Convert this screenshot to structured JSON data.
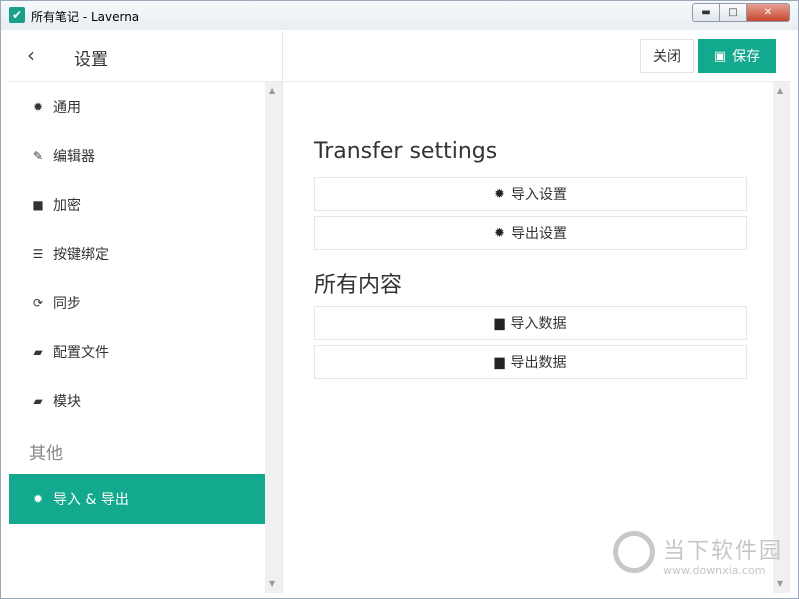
{
  "window": {
    "title": "所有笔记 - Laverna",
    "app_icon": "✔",
    "minimize": "▬",
    "maximize": "□",
    "close": "✕"
  },
  "sidebar": {
    "back_icon": "‹",
    "title": "设置",
    "items": [
      {
        "icon": "gear-icon",
        "glyph": "✹",
        "label": "通用"
      },
      {
        "icon": "pencil-icon",
        "glyph": "✎",
        "label": "编辑器"
      },
      {
        "icon": "lock-icon",
        "glyph": "■",
        "label": "加密"
      },
      {
        "icon": "keyboard-icon",
        "glyph": "☰",
        "label": "按键绑定"
      },
      {
        "icon": "sync-icon",
        "glyph": "⟳",
        "label": "同步"
      },
      {
        "icon": "book-icon",
        "glyph": "▰",
        "label": "配置文件"
      },
      {
        "icon": "book-icon",
        "glyph": "▰",
        "label": "模块"
      }
    ],
    "group_label": "其他",
    "active_item": {
      "icon": "gear-icon",
      "glyph": "✹",
      "label": "导入 & 导出"
    }
  },
  "toolbar": {
    "close_label": "关闭",
    "save_label": "保存",
    "save_glyph": "▣"
  },
  "main": {
    "section1_title": "Transfer settings",
    "import_settings": "导入设置",
    "export_settings": "导出设置",
    "section2_title": "所有内容",
    "import_data": "导入数据",
    "export_data": "导出数据",
    "gear_glyph": "✹",
    "file_glyph": "▆"
  },
  "scroll": {
    "up": "▲",
    "down": "▼"
  },
  "watermark": {
    "text": "当下软件园",
    "url": "www.downxia.com"
  },
  "colors": {
    "accent": "#13a98f",
    "sidebar_scroll": "#f0f0f0"
  }
}
